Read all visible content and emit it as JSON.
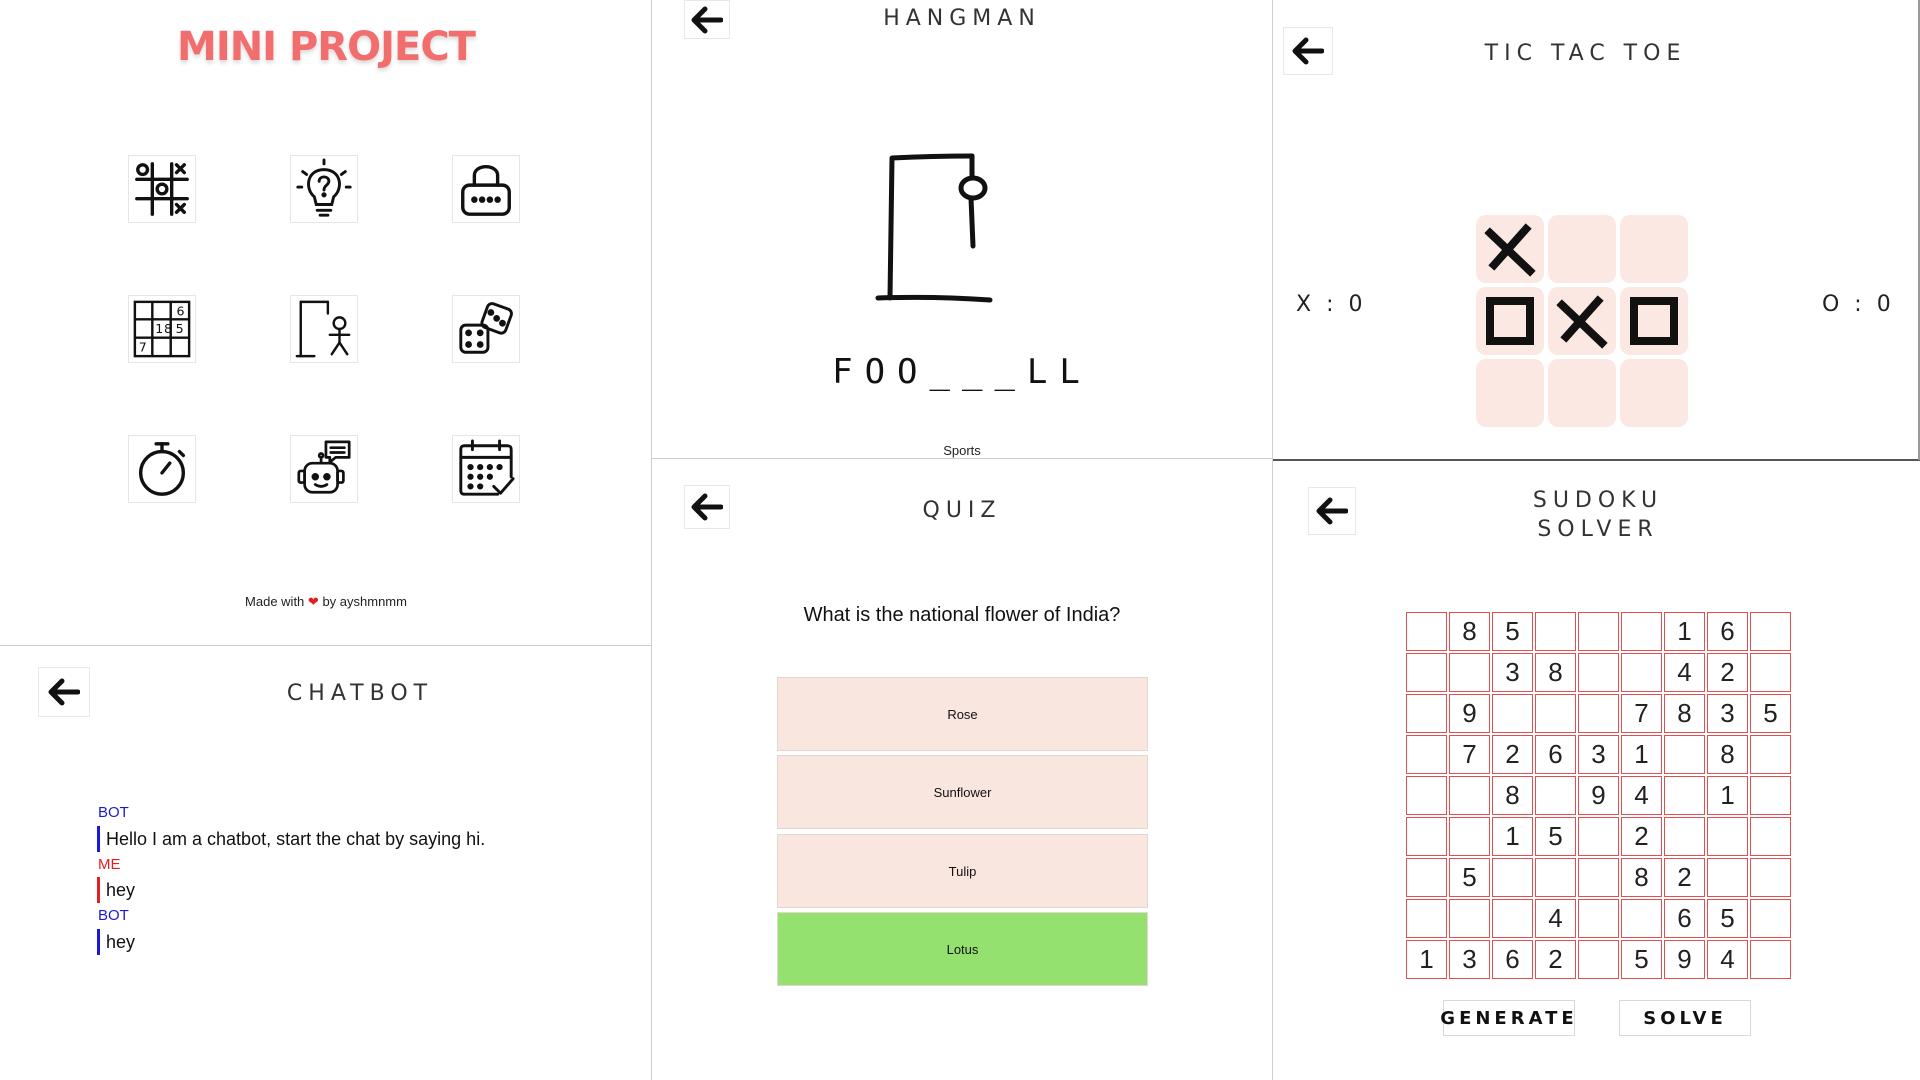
{
  "home": {
    "title": "MINI PROJECT",
    "apps": [
      {
        "name": "tic-tac-toe-icon"
      },
      {
        "name": "lightbulb-question-icon"
      },
      {
        "name": "password-lock-icon"
      },
      {
        "name": "sudoku-grid-icon"
      },
      {
        "name": "hangman-icon"
      },
      {
        "name": "dice-icon"
      },
      {
        "name": "stopwatch-icon"
      },
      {
        "name": "chatbot-icon"
      },
      {
        "name": "calendar-check-icon"
      }
    ],
    "footer_prefix": "Made with",
    "footer_heart": "❤",
    "footer_suffix": "by ayshmnmm"
  },
  "hangman": {
    "title": "HANGMAN",
    "word": "FOO___LL",
    "hint": "Sports"
  },
  "tictactoe": {
    "title": "TIC TAC TOE",
    "score_x": "X : 0",
    "score_o": "O : 0",
    "board": [
      "X",
      "",
      "",
      "O",
      "X",
      "O",
      "",
      "",
      ""
    ]
  },
  "quiz": {
    "title": "QUIZ",
    "question": "What is the national flower of India?",
    "options": [
      "Rose",
      "Sunflower",
      "Tulip",
      "Lotus"
    ],
    "correct_index": 3,
    "colors": {
      "option": "#f9e6df",
      "correct": "#95e16f"
    }
  },
  "chatbot": {
    "title": "CHATBOT",
    "messages": [
      {
        "who": "BOT",
        "text": "Hello I am a chatbot, start the chat by saying hi."
      },
      {
        "who": "ME",
        "text": "hey"
      },
      {
        "who": "BOT",
        "text": "hey"
      }
    ],
    "colors": {
      "bot": "#1a1ad6",
      "me": "#e02020"
    }
  },
  "sudoku": {
    "title_line1": "SUDOKU",
    "title_line2": "SOLVER",
    "grid": [
      [
        "",
        "8",
        "5",
        "",
        "",
        "",
        "1",
        "6",
        ""
      ],
      [
        "",
        "",
        "3",
        "8",
        "",
        "",
        "4",
        "2",
        ""
      ],
      [
        "",
        "9",
        "",
        "",
        "",
        "7",
        "8",
        "3",
        "5"
      ],
      [
        "",
        "7",
        "2",
        "6",
        "3",
        "1",
        "",
        "8",
        ""
      ],
      [
        "",
        "",
        "8",
        "",
        "9",
        "4",
        "",
        "1",
        ""
      ],
      [
        "",
        "",
        "1",
        "5",
        "",
        "2",
        "",
        "",
        ""
      ],
      [
        "",
        "5",
        "",
        "",
        "",
        "8",
        "2",
        "",
        ""
      ],
      [
        "",
        "",
        "",
        "4",
        "",
        "",
        "6",
        "5",
        ""
      ],
      [
        "1",
        "3",
        "6",
        "2",
        "",
        "5",
        "9",
        "4",
        ""
      ]
    ],
    "generate_label": "GENERATE",
    "solve_label": "SOLVE"
  },
  "colors": {
    "home_title": "#f26d6d",
    "ttt_cell": "#fbe8e2",
    "sudoku_border": "#e05050"
  }
}
